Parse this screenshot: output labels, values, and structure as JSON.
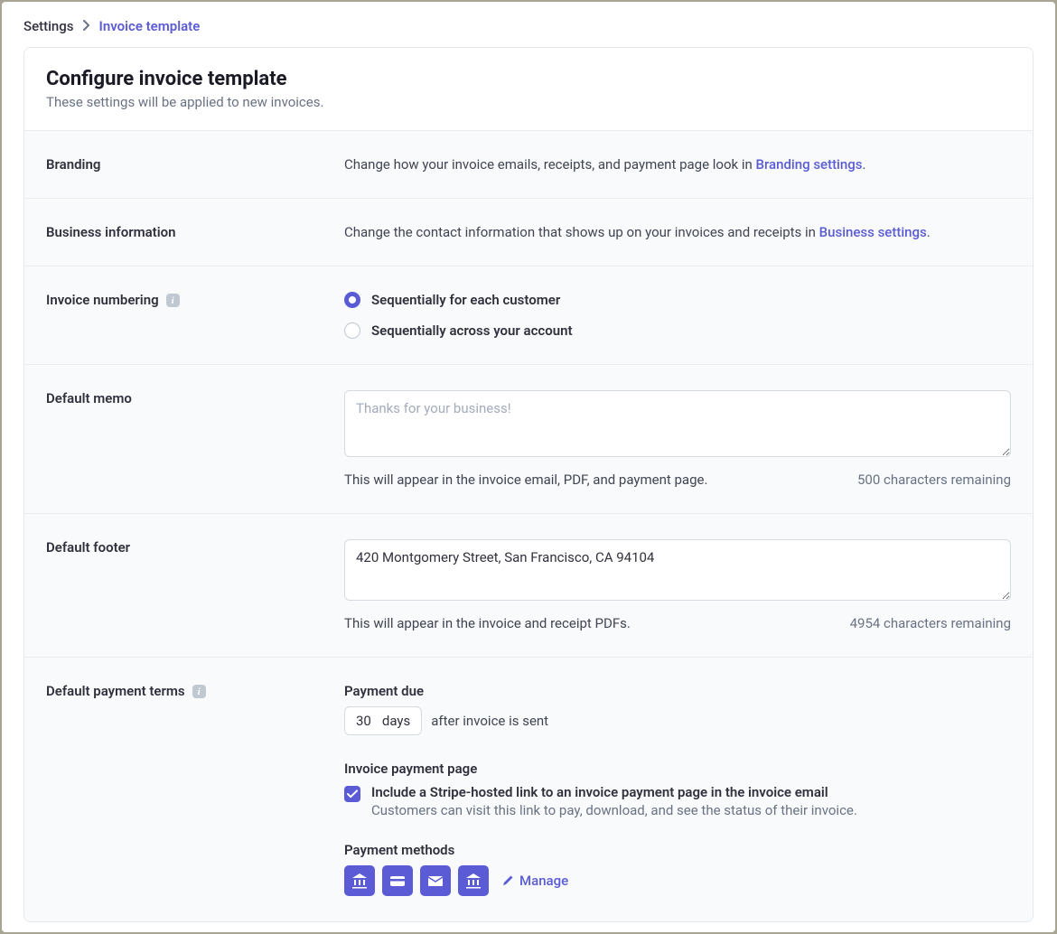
{
  "breadcrumb": {
    "root": "Settings",
    "leaf": "Invoice template"
  },
  "header": {
    "title": "Configure invoice template",
    "subtitle": "These settings will be applied to new invoices."
  },
  "branding": {
    "label": "Branding",
    "desc_pre": "Change how your invoice emails, receipts, and payment page look in ",
    "link": "Branding settings",
    "desc_post": "."
  },
  "business": {
    "label": "Business information",
    "desc_pre": "Change the contact information that shows up on your invoices and receipts in ",
    "link": "Business settings",
    "desc_post": "."
  },
  "numbering": {
    "label": "Invoice numbering",
    "option_customer": "Sequentially for each customer",
    "option_account": "Sequentially across your account"
  },
  "memo": {
    "label": "Default memo",
    "placeholder": "Thanks for your business!",
    "value": "",
    "help": "This will appear in the invoice email, PDF, and payment page.",
    "remaining": "500 characters remaining"
  },
  "footer": {
    "label": "Default footer",
    "value": "420 Montgomery Street, San Francisco, CA 94104",
    "help": "This will appear in the invoice and receipt PDFs.",
    "remaining": "4954 characters remaining"
  },
  "terms": {
    "label": "Default payment terms",
    "payment_due_label": "Payment due",
    "days_value": "30",
    "days_unit": "days",
    "after_text": "after invoice is sent",
    "page_label": "Invoice payment page",
    "check_title": "Include a Stripe-hosted link to an invoice payment page in the invoice email",
    "check_desc": "Customers can visit this link to pay, download, and see the status of their invoice.",
    "methods_label": "Payment methods",
    "manage_label": "Manage"
  }
}
